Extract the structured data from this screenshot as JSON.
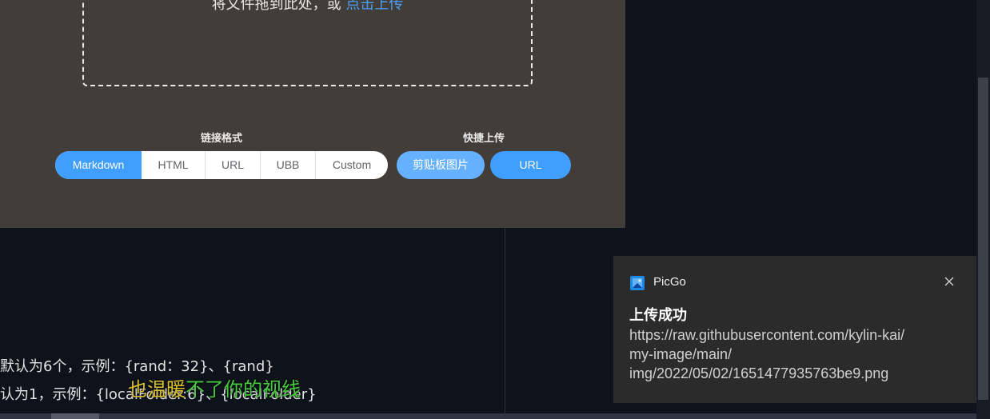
{
  "upload": {
    "drop_text": "将文件拖到此处，或 ",
    "click_upload": "点击上传"
  },
  "link_format": {
    "title": "链接格式",
    "options": [
      "Markdown",
      "HTML",
      "URL",
      "UBB",
      "Custom"
    ],
    "selected": "Markdown"
  },
  "quick_upload": {
    "title": "快捷上传",
    "clipboard_label": "剪贴板图片",
    "url_label": "URL"
  },
  "background": {
    "line1": "默认为6个，示例：{rand：32}、{rand}",
    "line2": "认为1，示例：{localFolder:6}、{localFolder}",
    "lyric_highlight": "也温暖",
    "lyric_rest": "不了你的视线"
  },
  "notification": {
    "app_name": "PicGo",
    "title": "上传成功",
    "body_line1": "https://raw.githubusercontent.com/kylin-kai/",
    "body_line2": "my-image/main/",
    "body_line3": "img/2022/05/02/1651477935763be9.png"
  },
  "colors": {
    "accent": "#409eff",
    "panel_bg": "#423d38",
    "toast_bg": "#2b2b2b"
  }
}
